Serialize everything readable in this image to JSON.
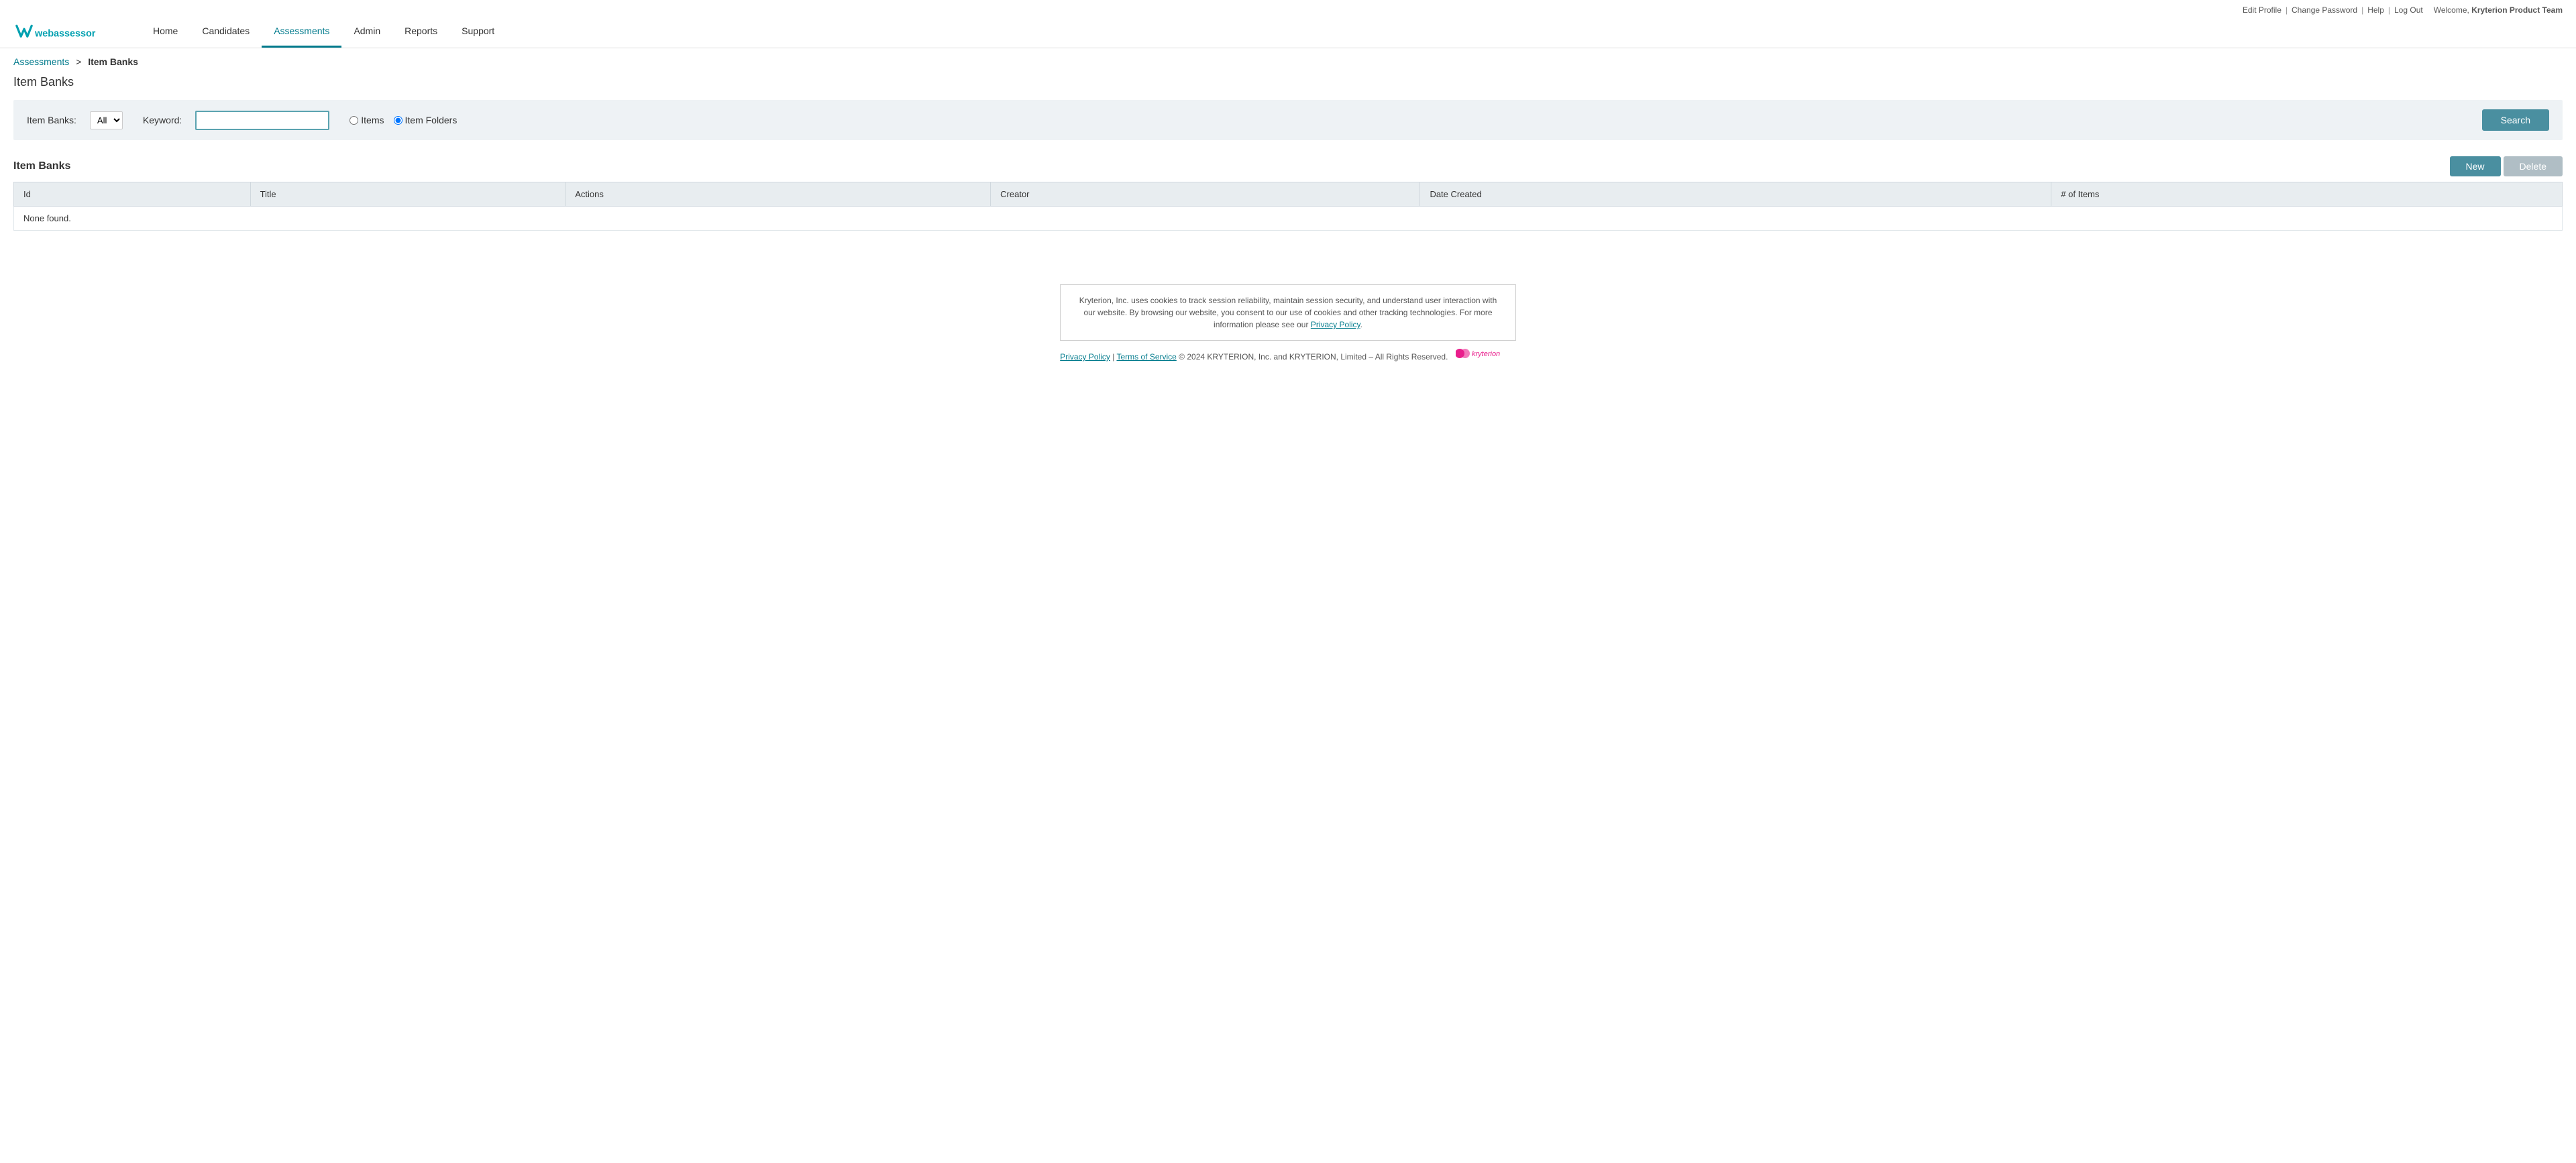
{
  "topbar": {
    "edit_profile": "Edit Profile",
    "change_password": "Change Password",
    "help": "Help",
    "log_out": "Log Out",
    "welcome_text": "Welcome,",
    "user_name": "Kryterion Product Team"
  },
  "nav": {
    "items": [
      {
        "label": "Home",
        "active": false
      },
      {
        "label": "Candidates",
        "active": false
      },
      {
        "label": "Assessments",
        "active": true
      },
      {
        "label": "Admin",
        "active": false
      },
      {
        "label": "Reports",
        "active": false
      },
      {
        "label": "Support",
        "active": false
      }
    ]
  },
  "breadcrumb": {
    "parent": "Assessments",
    "separator": ">",
    "current": "Item Banks"
  },
  "page_title": "Item Banks",
  "filter": {
    "item_banks_label": "Item Banks:",
    "item_banks_default": "All",
    "keyword_label": "Keyword:",
    "keyword_placeholder": "",
    "radio_items_label": "Items",
    "radio_folders_label": "Item Folders",
    "search_button": "Search"
  },
  "table_section": {
    "title": "Item Banks",
    "new_button": "New",
    "delete_button": "Delete",
    "columns": [
      "Id",
      "Title",
      "Actions",
      "Creator",
      "Date Created",
      "# of Items"
    ],
    "empty_message": "None found."
  },
  "footer": {
    "cookie_text": "Kryterion, Inc. uses cookies to track session reliability, maintain session security, and understand user interaction with our website. By browsing our website, you consent to our use of cookies and other tracking technologies. For more information please see our",
    "privacy_policy_link": "Privacy Policy",
    "privacy_policy_label": "Privacy Policy",
    "terms_label": "Terms of Service",
    "copyright": "© 2024  KRYTERION, Inc. and KRYTERION, Limited – All Rights Reserved.",
    "kryterion_brand": "kryterion"
  }
}
